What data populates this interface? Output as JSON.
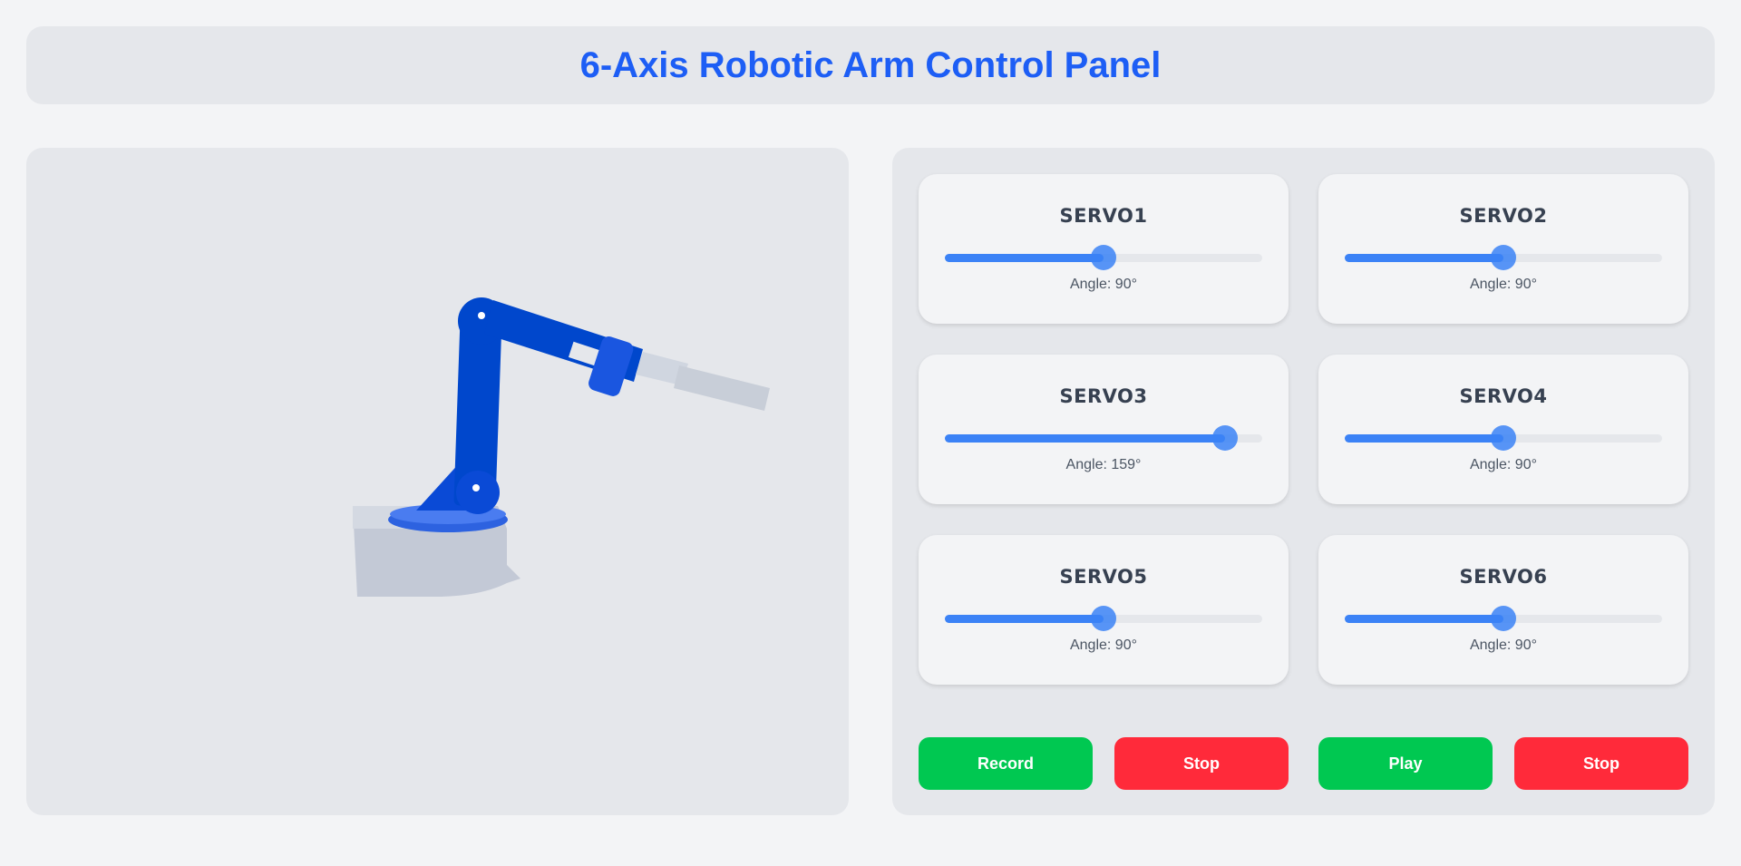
{
  "header": {
    "title": "6-Axis Robotic Arm Control Panel"
  },
  "servos": [
    {
      "name": "SERVO1",
      "angle": 90,
      "angle_label": "Angle: 90°"
    },
    {
      "name": "SERVO2",
      "angle": 90,
      "angle_label": "Angle: 90°"
    },
    {
      "name": "SERVO3",
      "angle": 159,
      "angle_label": "Angle: 159°"
    },
    {
      "name": "SERVO4",
      "angle": 90,
      "angle_label": "Angle: 90°"
    },
    {
      "name": "SERVO5",
      "angle": 90,
      "angle_label": "Angle: 90°"
    },
    {
      "name": "SERVO6",
      "angle": 90,
      "angle_label": "Angle: 90°"
    }
  ],
  "slider_range": [
    0,
    180
  ],
  "buttons": {
    "record": "Record",
    "stop1": "Stop",
    "play": "Play",
    "stop2": "Stop"
  },
  "colors": {
    "accent": "#1d5ef5",
    "slider": "#3b82f6",
    "green": "#00c851",
    "red": "#ff2a3a",
    "arm": "#0047cc"
  }
}
